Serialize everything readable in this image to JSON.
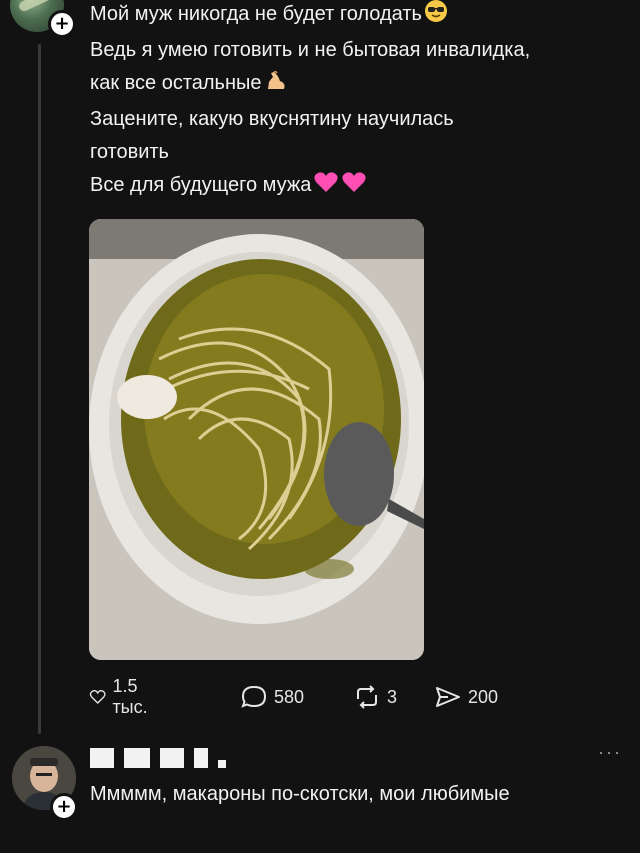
{
  "post": {
    "lines": [
      "Мой муж никогда не будет голодать",
      "Ведь я умею готовить и не бытовая инвалидка,",
      "как все остальные",
      "Зацените, какую вкуснятину научилась",
      "готовить",
      "Все для будущего мужа"
    ],
    "photo_alt_icon": "soup-with-pasta-photo"
  },
  "actions": {
    "likes": "1.5 тыс.",
    "comments": "580",
    "reposts": "3",
    "shares": "200"
  },
  "reply": {
    "text": "Ммммм, макароны по-скотски, мои любимые"
  },
  "more_label": "···",
  "plus_label": "+"
}
